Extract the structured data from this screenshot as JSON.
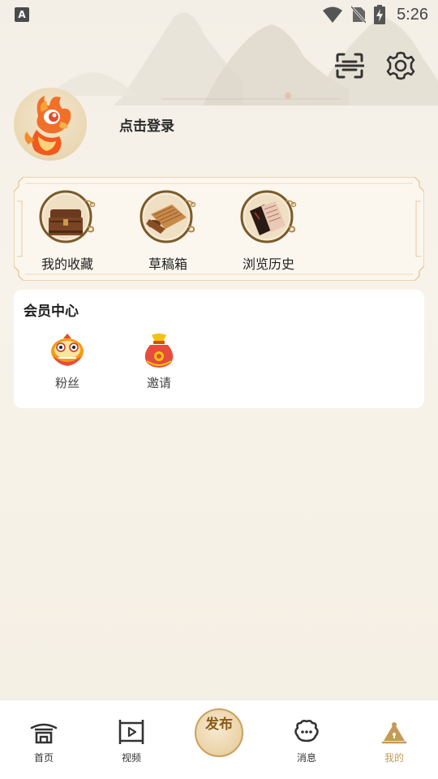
{
  "status_bar": {
    "app_icon_letter": "A",
    "time": "5:26",
    "icons": [
      "wifi-icon",
      "no-sim-icon",
      "battery-charging-icon"
    ]
  },
  "top_actions": {
    "icons": [
      "scan-icon",
      "gear-icon"
    ]
  },
  "profile": {
    "login_text": "点击登录"
  },
  "quick_links": [
    {
      "label": "我的收藏",
      "icon": "treasure-chest-icon"
    },
    {
      "label": "草稿箱",
      "icon": "scroll-icon"
    },
    {
      "label": "浏览历史",
      "icon": "book-icon"
    }
  ],
  "member_center": {
    "title": "会员中心",
    "items": [
      {
        "label": "粉丝",
        "icon": "lion-dance-icon"
      },
      {
        "label": "邀请",
        "icon": "lucky-bag-icon"
      }
    ]
  },
  "bottom_nav": {
    "items": [
      {
        "label": "首页",
        "icon": "home-pavilion-icon"
      },
      {
        "label": "视频",
        "icon": "video-frame-icon"
      },
      {
        "label": "发布",
        "icon": "publish-icon"
      },
      {
        "label": "消息",
        "icon": "message-cloud-icon"
      },
      {
        "label": "我的",
        "icon": "profile-mountain-icon"
      }
    ],
    "active": "我的",
    "active_color": "#c49a55"
  },
  "colors": {
    "background": "#f6f2e8",
    "accent_gold": "#c49a55",
    "card_border": "#e8c99a"
  }
}
